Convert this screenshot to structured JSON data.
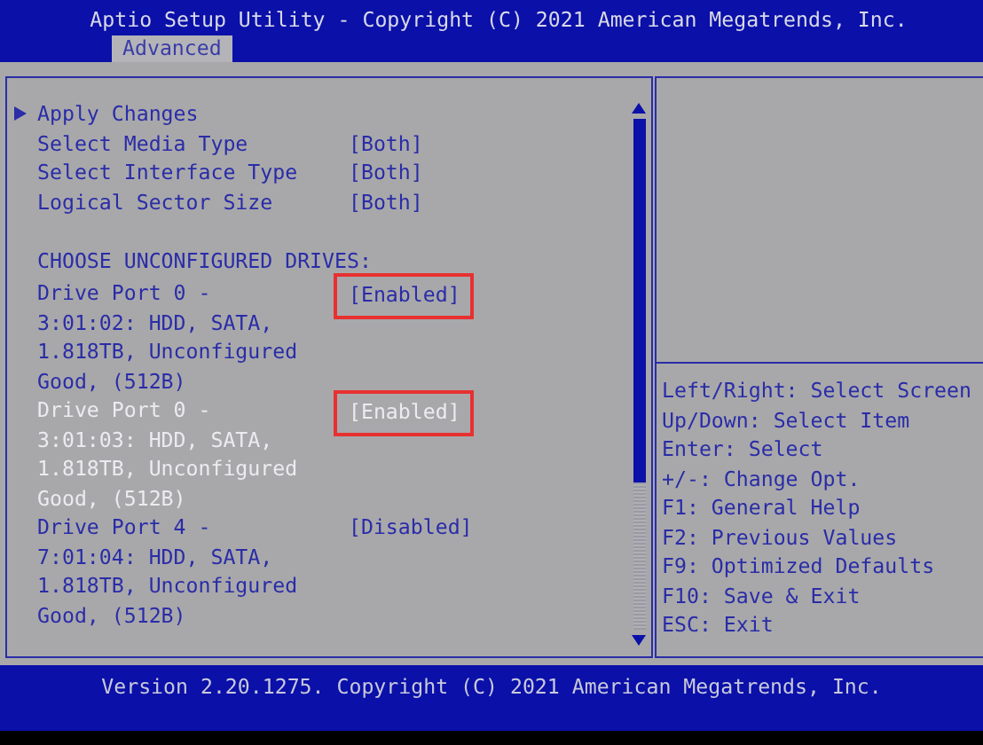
{
  "window": {
    "title": "Aptio Setup Utility - Copyright (C) 2021 American Megatrends, Inc."
  },
  "tabs": [
    {
      "label": "Advanced",
      "selected": true
    }
  ],
  "items": [
    {
      "kind": "submenu",
      "label": "Apply Changes"
    },
    {
      "kind": "setting",
      "label": "Select Media Type",
      "value": "[Both]",
      "selected": false,
      "highlighted": false
    },
    {
      "kind": "setting",
      "label": "Select Interface Type",
      "value": "[Both]",
      "selected": false,
      "highlighted": false
    },
    {
      "kind": "setting",
      "label": "Logical Sector Size",
      "value": "[Both]",
      "selected": false,
      "highlighted": false
    },
    {
      "kind": "heading",
      "label": "CHOOSE UNCONFIGURED DRIVES:"
    },
    {
      "kind": "setting",
      "label": "Drive Port 0 - 3:01:02: HDD, SATA, 1.818TB, Unconfigured Good, (512B)",
      "value": "[Enabled]",
      "selected": false,
      "highlighted": true
    },
    {
      "kind": "setting",
      "label": "Drive Port 0 - 3:01:03: HDD, SATA, 1.818TB, Unconfigured Good, (512B)",
      "value": "[Enabled]",
      "selected": true,
      "highlighted": true
    },
    {
      "kind": "setting",
      "label": "Drive Port 4 - 7:01:04: HDD, SATA, 1.818TB, Unconfigured Good, (512B)",
      "value": "[Disabled]",
      "selected": false,
      "highlighted": false
    }
  ],
  "help": [
    "Left/Right: Select Screen",
    "Up/Down: Select Item",
    "Enter: Select",
    "+/-: Change Opt.",
    "F1: General Help",
    "F2: Previous Values",
    "F9: Optimized Defaults",
    "F10: Save & Exit",
    "ESC: Exit"
  ],
  "status_bar": "Version 2.20.1275. Copyright (C) 2021 American Megatrends, Inc."
}
